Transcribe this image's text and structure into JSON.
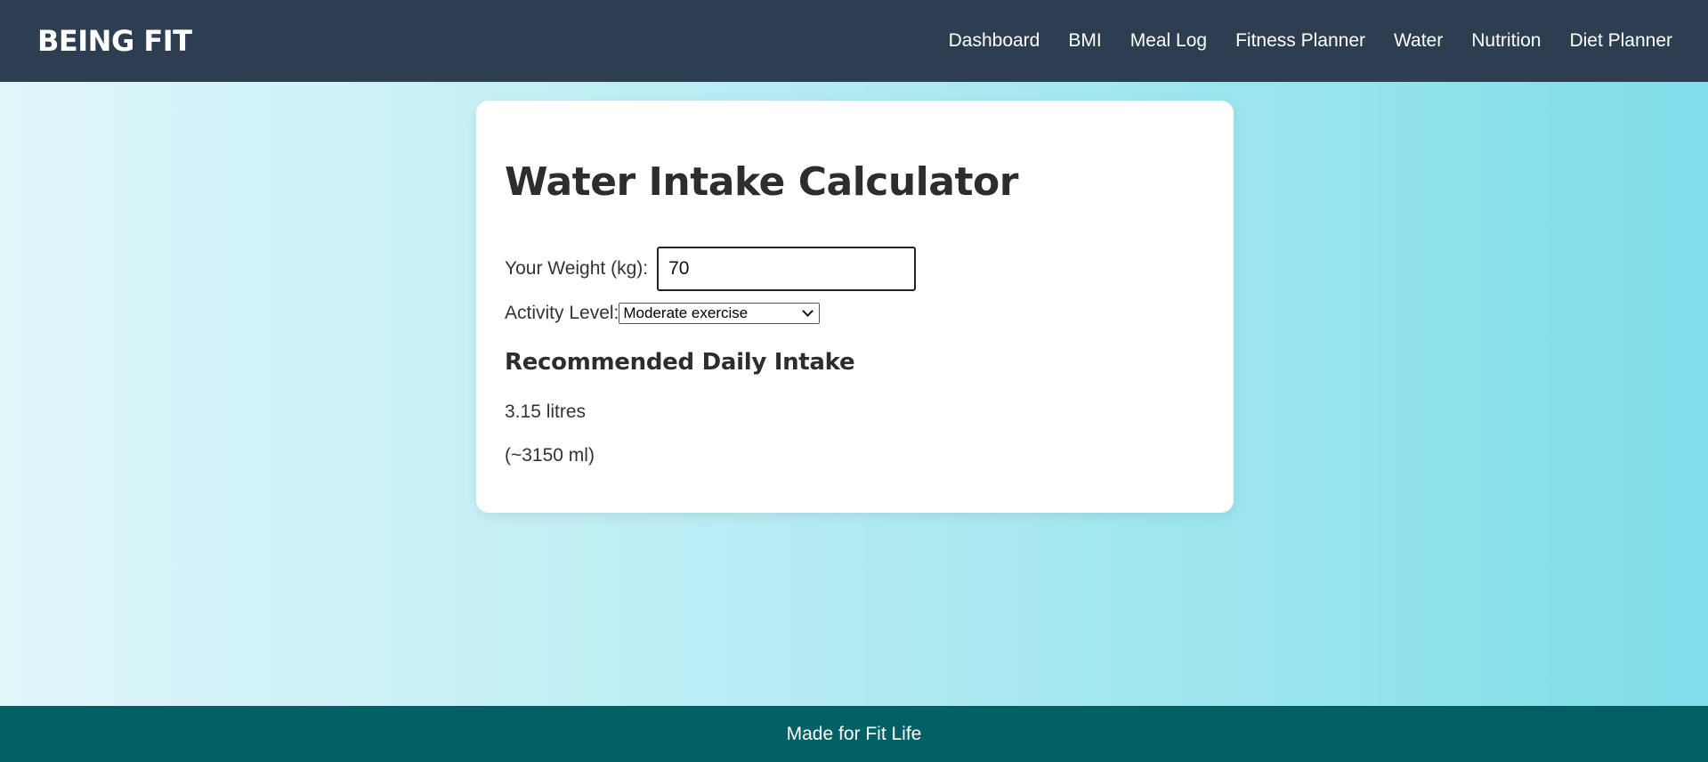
{
  "navbar": {
    "brand": "BEING FIT",
    "links": [
      {
        "label": "Dashboard"
      },
      {
        "label": "BMI"
      },
      {
        "label": "Meal Log"
      },
      {
        "label": "Fitness Planner"
      },
      {
        "label": "Water"
      },
      {
        "label": "Nutrition"
      },
      {
        "label": "Diet Planner"
      }
    ],
    "background_color": "#2c3e50"
  },
  "calculator": {
    "title": "Water Intake Calculator",
    "weight_label": "Your Weight (kg):",
    "weight_value": "70",
    "activity_label": "Activity Level:",
    "activity_selected": "Moderate exercise",
    "result_heading": "Recommended Daily Intake",
    "result_litres": "3.15 litres",
    "result_ml": "(~3150 ml)"
  },
  "footer": {
    "text": "Made for Fit Life",
    "background_color": "#006064"
  },
  "icons": {
    "select_arrow": "chevron-down-icon"
  }
}
